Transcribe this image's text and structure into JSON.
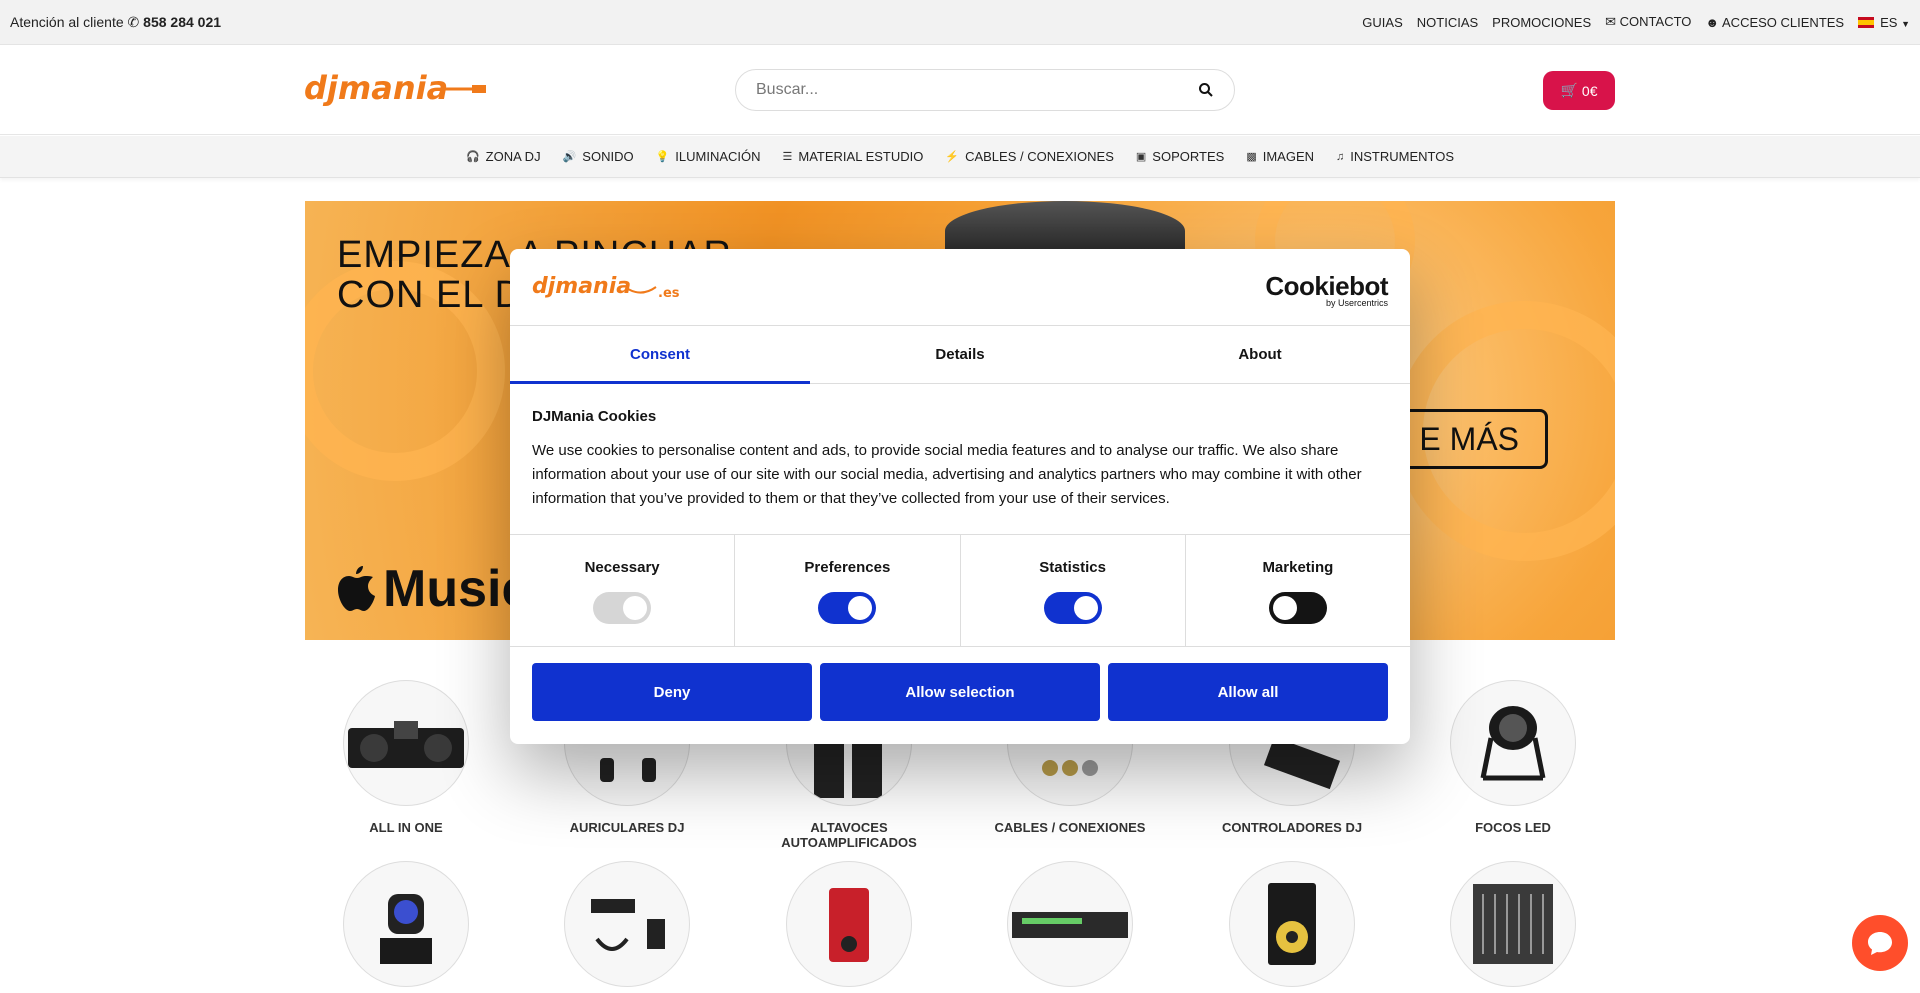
{
  "topbar": {
    "support_label": "Atención al cliente",
    "phone": "858 284 021",
    "links": [
      "GUIAS",
      "NOTICIAS",
      "PROMOCIONES",
      "CONTACTO",
      "ACCESO CLIENTES"
    ],
    "language": "ES"
  },
  "header": {
    "logo_text": "djmania",
    "search_placeholder": "Buscar...",
    "cart_total": "0€"
  },
  "nav": {
    "items": [
      "ZONA DJ",
      "SONIDO",
      "ILUMINACIÓN",
      "MATERIAL ESTUDIO",
      "CABLES / CONEXIONES",
      "SOPORTES",
      "IMAGEN",
      "INSTRUMENTOS"
    ]
  },
  "banner": {
    "line1": "EMPIEZA A PINCHAR",
    "line2": "CON EL D",
    "cta": "E MÁS",
    "brand": "Music"
  },
  "categories": {
    "row1": [
      "ALL IN ONE",
      "AURICULARES DJ",
      "ALTAVOCES AUTOAMPLIFICADOS",
      "CABLES / CONEXIONES",
      "CONTROLADORES DJ",
      "FOCOS LED"
    ]
  },
  "cookie": {
    "logo_text": "djmania",
    "logo_suffix": ".es",
    "provider": "Cookiebot",
    "provider_by": "by Usercentrics",
    "tabs": [
      "Consent",
      "Details",
      "About"
    ],
    "title": "DJMania Cookies",
    "body": "We use cookies to personalise content and ads, to provide social media features and to analyse our traffic. We also share information about your use of our site with our social media, advertising and analytics partners who may combine it with other information that you’ve provided to them or that they’ve collected from your use of their services.",
    "toggles": [
      {
        "name": "Necessary",
        "state": "on-disabled"
      },
      {
        "name": "Preferences",
        "state": "on"
      },
      {
        "name": "Statistics",
        "state": "on"
      },
      {
        "name": "Marketing",
        "state": "off"
      }
    ],
    "buttons": [
      "Deny",
      "Allow selection",
      "Allow all"
    ]
  },
  "colors": {
    "accent": "#1032cf",
    "cart": "#d8134a",
    "brand_orange": "#f07a1a",
    "chat": "#ff4e2b"
  }
}
